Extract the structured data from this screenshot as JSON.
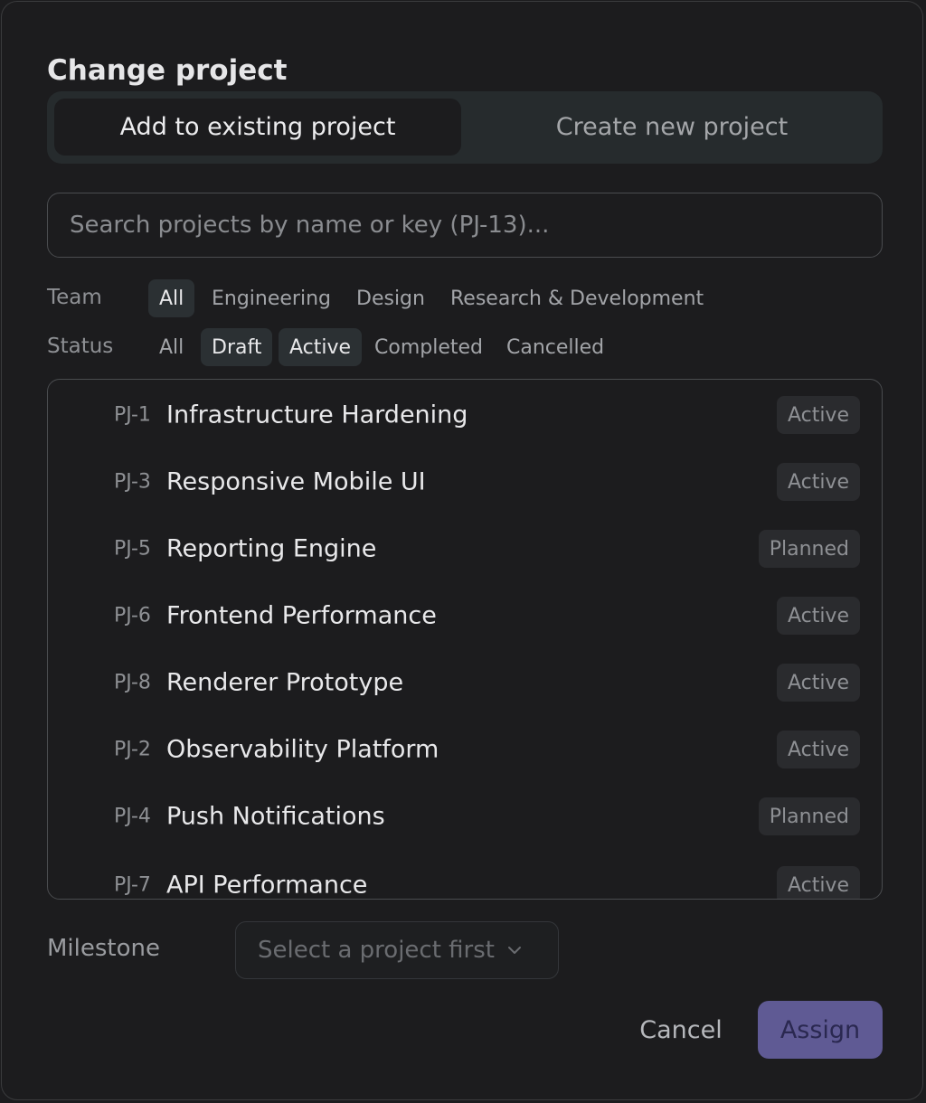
{
  "dialog": {
    "title": "Change project"
  },
  "mode_tabs": {
    "existing": "Add to existing project",
    "create": "Create new project",
    "selected": "existing"
  },
  "search": {
    "placeholder": "Search projects by name or key (PJ-13)...",
    "value": ""
  },
  "filters": {
    "team": {
      "label": "Team",
      "options": [
        "All",
        "Engineering",
        "Design",
        "Research & Development"
      ],
      "selected": [
        "All"
      ]
    },
    "status": {
      "label": "Status",
      "options": [
        "All",
        "Draft",
        "Active",
        "Completed",
        "Cancelled"
      ],
      "selected": [
        "Draft",
        "Active"
      ]
    }
  },
  "projects": [
    {
      "key": "PJ-1",
      "name": "Infrastructure Hardening",
      "status": "Active"
    },
    {
      "key": "PJ-3",
      "name": "Responsive Mobile UI",
      "status": "Active"
    },
    {
      "key": "PJ-5",
      "name": "Reporting Engine",
      "status": "Planned"
    },
    {
      "key": "PJ-6",
      "name": "Frontend Performance",
      "status": "Active"
    },
    {
      "key": "PJ-8",
      "name": "Renderer Prototype",
      "status": "Active"
    },
    {
      "key": "PJ-2",
      "name": "Observability Platform",
      "status": "Active"
    },
    {
      "key": "PJ-4",
      "name": "Push Notifications",
      "status": "Planned"
    },
    {
      "key": "PJ-7",
      "name": "API Performance",
      "status": "Active"
    }
  ],
  "milestone": {
    "label": "Milestone",
    "placeholder": "Select a project first",
    "disabled": true
  },
  "actions": {
    "cancel": "Cancel",
    "assign": "Assign"
  },
  "colors": {
    "background": "#1c1c1e",
    "primary_button": "#5f5a94",
    "chip_selected": "#2b3033"
  },
  "icons": {
    "milestone_dropdown": "chevron-down-icon"
  }
}
